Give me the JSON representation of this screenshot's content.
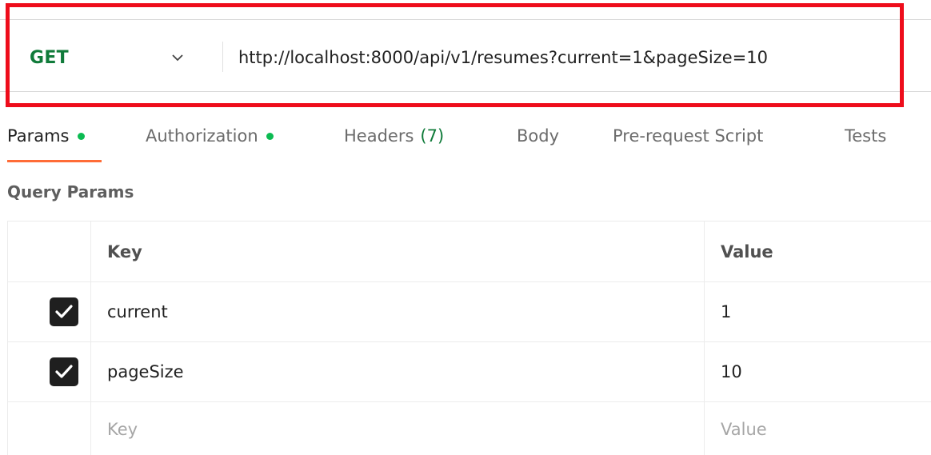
{
  "request": {
    "method": "GET",
    "url": "http://localhost:8000/api/v1/resumes?current=1&pageSize=10"
  },
  "tabs": [
    {
      "label": "Params",
      "active": true,
      "indicator": "green-dot"
    },
    {
      "label": "Authorization",
      "active": false,
      "indicator": "green-dot"
    },
    {
      "label": "Headers",
      "count": "(7)",
      "active": false
    },
    {
      "label": "Body",
      "active": false
    },
    {
      "label": "Pre-request Script",
      "active": false
    },
    {
      "label": "Tests",
      "active": false
    }
  ],
  "query_params": {
    "title": "Query Params",
    "headers": {
      "key": "Key",
      "value": "Value"
    },
    "rows": [
      {
        "checked": true,
        "key": "current",
        "value": "1"
      },
      {
        "checked": true,
        "key": "pageSize",
        "value": "10"
      }
    ],
    "empty_row": {
      "key_placeholder": "Key",
      "value_placeholder": "Value"
    }
  },
  "colors": {
    "method": "#107b3a",
    "active_tab_underline": "#ff6c37",
    "status_dot": "#0cbb52",
    "highlight_box": "#ee0d1b"
  }
}
